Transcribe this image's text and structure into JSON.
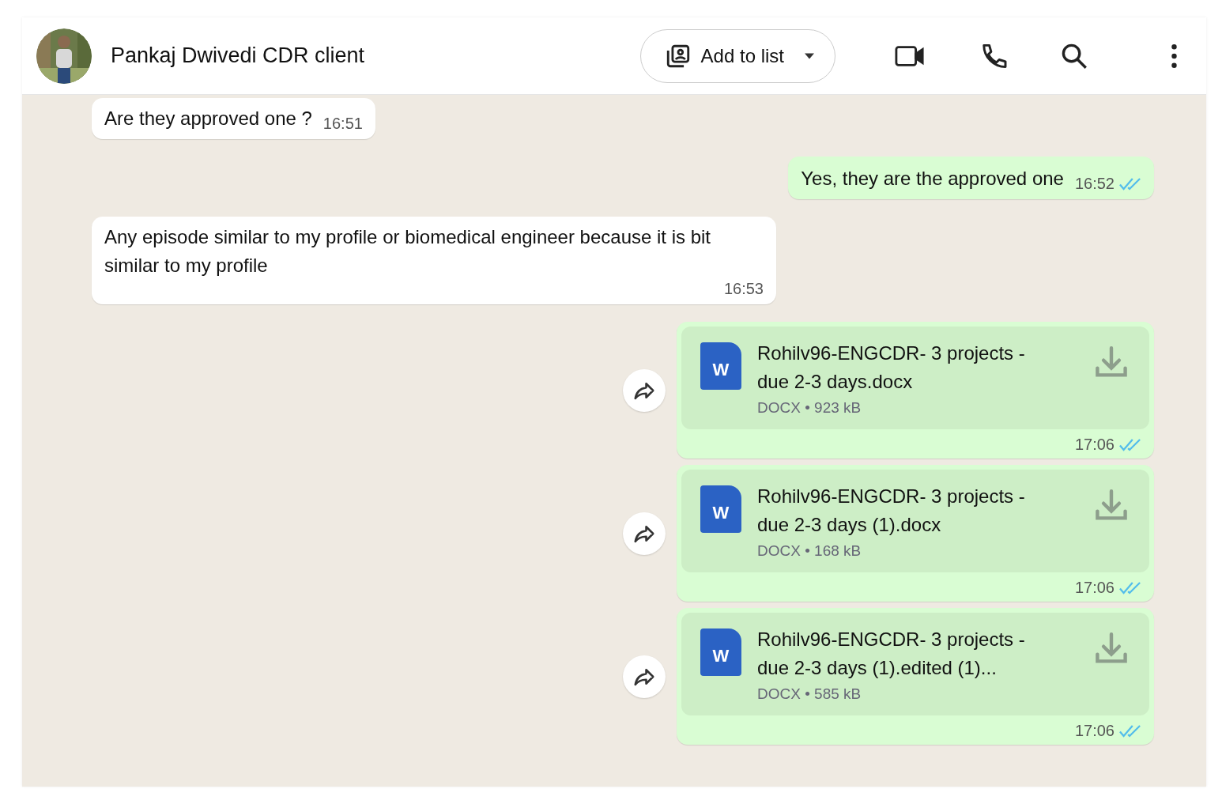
{
  "header": {
    "title": "Pankaj Dwivedi CDR client",
    "add_to_list": {
      "label": "Add to list"
    }
  },
  "messages": [
    {
      "kind": "text",
      "outgoing": false,
      "text": "Are they approved one ?",
      "time": "16:51"
    },
    {
      "kind": "text",
      "outgoing": true,
      "text": "Yes, they are the approved one",
      "time": "16:52",
      "read": true
    },
    {
      "kind": "text",
      "outgoing": false,
      "text": "Any episode similar to my profile or biomedical engineer because it is bit similar to my profile",
      "time": "16:53"
    },
    {
      "kind": "document",
      "outgoing": true,
      "file_icon": "W",
      "file_name": "Rohilv96-ENGCDR- 3 projects - due 2-3 days.docx",
      "file_info": "DOCX • 923 kB",
      "time": "17:06",
      "read": true
    },
    {
      "kind": "document",
      "outgoing": true,
      "file_icon": "W",
      "file_name": "Rohilv96-ENGCDR- 3 projects - due 2-3 days (1).docx",
      "file_info": "DOCX • 168 kB",
      "time": "17:06",
      "read": true
    },
    {
      "kind": "document",
      "outgoing": true,
      "file_icon": "W",
      "file_name": "Rohilv96-ENGCDR- 3 projects - due 2-3 days (1).edited (1)...",
      "file_info": "DOCX • 585 kB",
      "time": "17:06",
      "read": true
    }
  ]
}
